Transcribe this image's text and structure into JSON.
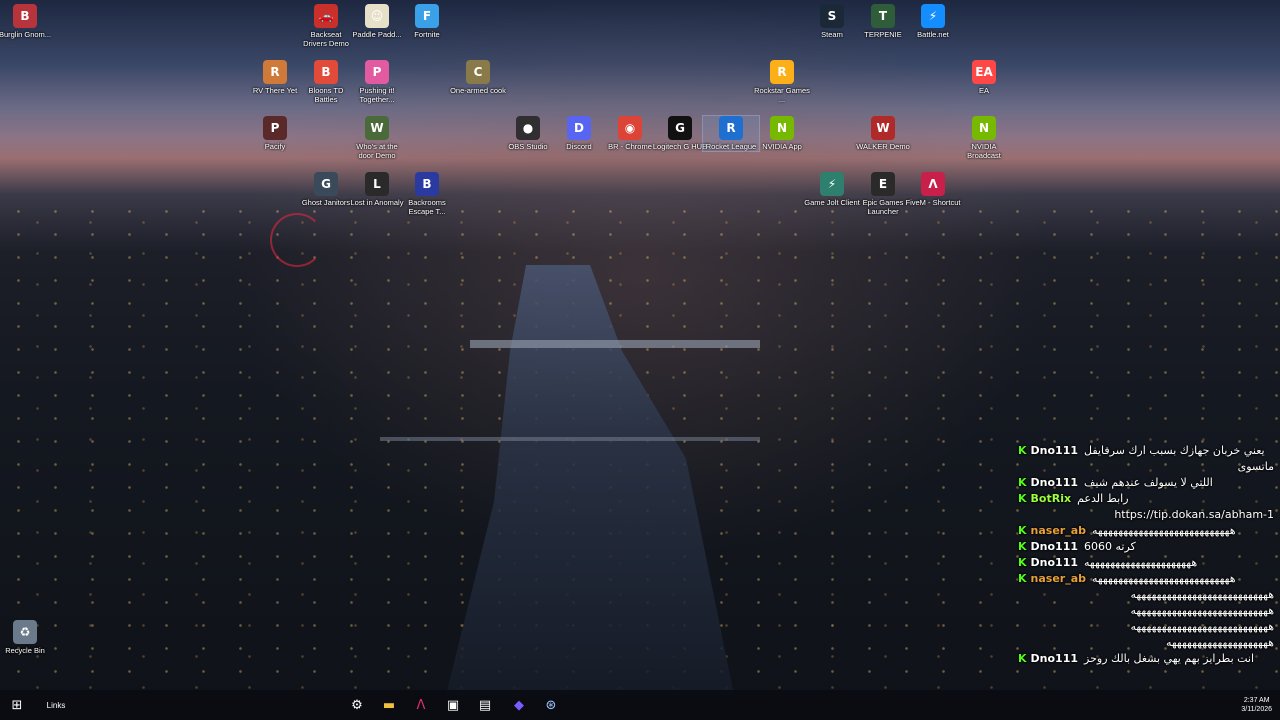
{
  "desktop_icons": [
    {
      "name": "burglin-gnomes-icon",
      "label": "Burglin Gnom...",
      "glyph": "B",
      "color": "#b8343c"
    },
    {
      "name": "backseat-drivers-icon",
      "label": "Backseat Drivers Demo",
      "glyph": "🚗",
      "color": "#c9302c"
    },
    {
      "name": "paddle-icon",
      "label": "Paddle Padd...",
      "glyph": "☺",
      "color": "#e6e0c8"
    },
    {
      "name": "fortnite-icon",
      "label": "Fortnite",
      "glyph": "F",
      "color": "#3aa0e8"
    },
    {
      "name": "steam-icon",
      "label": "Steam",
      "glyph": "S",
      "color": "#1b2838"
    },
    {
      "name": "terpenie-icon",
      "label": "TERPENIE",
      "glyph": "T",
      "color": "#2f5d3a"
    },
    {
      "name": "battlenet-icon",
      "label": "Battle.net",
      "glyph": "⚡",
      "color": "#148eff"
    },
    {
      "name": "rv-there-yet-icon",
      "label": "RV There Yet",
      "glyph": "R",
      "color": "#d07a3a"
    },
    {
      "name": "bloons-td-icon",
      "label": "Bloons TD Battles",
      "glyph": "B",
      "color": "#e24a3a"
    },
    {
      "name": "pushing-it-icon",
      "label": "Pushing it! Together...",
      "glyph": "P",
      "color": "#e25aa0"
    },
    {
      "name": "one-armed-cook-icon",
      "label": "One-armed cook",
      "glyph": "C",
      "color": "#8a7a4a"
    },
    {
      "name": "rockstar-games-icon",
      "label": "Rockstar Games ...",
      "glyph": "R",
      "color": "#fcaf17"
    },
    {
      "name": "ea-icon",
      "label": "EA",
      "glyph": "EA",
      "color": "#ff4747"
    },
    {
      "name": "pacify-icon",
      "label": "Pacify",
      "glyph": "P",
      "color": "#5a2a2a"
    },
    {
      "name": "whos-at-the-door-icon",
      "label": "Who's at the door Demo",
      "glyph": "W",
      "color": "#4a6a3a"
    },
    {
      "name": "obs-studio-icon",
      "label": "OBS Studio",
      "glyph": "●",
      "color": "#302e31"
    },
    {
      "name": "discord-icon",
      "label": "Discord",
      "glyph": "D",
      "color": "#5865f2"
    },
    {
      "name": "chrome-icon",
      "label": "BR - Chrome",
      "glyph": "◉",
      "color": "#db4437"
    },
    {
      "name": "logitech-g-hub-icon",
      "label": "Logitech G HUB",
      "glyph": "G",
      "color": "#111111"
    },
    {
      "name": "rocket-league-icon",
      "label": "Rocket League",
      "glyph": "R",
      "color": "#1f6fd0"
    },
    {
      "name": "nvidia-app-icon",
      "label": "NVIDIA App",
      "glyph": "N",
      "color": "#76b900"
    },
    {
      "name": "walker-demo-icon",
      "label": "WALKER Demo",
      "glyph": "W",
      "color": "#b02a2a"
    },
    {
      "name": "nvidia-broadcast-icon",
      "label": "NVIDIA Broadcast",
      "glyph": "N",
      "color": "#76b900"
    },
    {
      "name": "ghost-janitors-icon",
      "label": "Ghost Janitors",
      "glyph": "G",
      "color": "#3a4a5a"
    },
    {
      "name": "lost-in-anomaly-icon",
      "label": "Lost in Anomaly",
      "glyph": "L",
      "color": "#2a2a2a"
    },
    {
      "name": "backrooms-escape-icon",
      "label": "Backrooms Escape T...",
      "glyph": "B",
      "color": "#2a3aa0"
    },
    {
      "name": "game-jolt-icon",
      "label": "Game Jolt Client",
      "glyph": "⚡",
      "color": "#2f7f6f"
    },
    {
      "name": "epic-games-icon",
      "label": "Epic Games Launcher",
      "glyph": "E",
      "color": "#2a2a2a"
    },
    {
      "name": "fivem-icon",
      "label": "FiveM - Shortcut",
      "glyph": "Λ",
      "color": "#c8204a"
    },
    {
      "name": "recycle-bin-icon",
      "label": "Recycle Bin",
      "glyph": "♻",
      "color": "#6a7a8a"
    }
  ],
  "chat": [
    {
      "user": "Dno111",
      "color": "#ffffff",
      "text": "يعني خربان جهازك بسبب ارك سرفايفل"
    },
    {
      "user": "",
      "color": "#ffffff",
      "text": "ماتسوى"
    },
    {
      "user": "Dno111",
      "color": "#ffffff",
      "text": "اللتي لا يسولف عندهم شيف"
    },
    {
      "user": "BotRix",
      "color": "#9bff3b",
      "text": "رابط الدعم"
    },
    {
      "user": "",
      "color": "#ffffff",
      "text": "https://tip.dokan.sa/abham-1"
    },
    {
      "user": "naser_ab",
      "color": "#e8a13a",
      "text": "هههههههههههههههههههههههههههه"
    },
    {
      "user": "Dno111",
      "color": "#ffffff",
      "text": "كرته 6060"
    },
    {
      "user": "Dno111",
      "color": "#ffffff",
      "text": "هههههههههههههههههههههه"
    },
    {
      "user": "naser_ab",
      "color": "#e8a13a",
      "text": "هههههههههههههههههههههههههههه"
    },
    {
      "user": "",
      "color": "#ffffff",
      "text": "هههههههههههههههههههههههههههه"
    },
    {
      "user": "",
      "color": "#ffffff",
      "text": "هههههههههههههههههههههههههههه"
    },
    {
      "user": "",
      "color": "#ffffff",
      "text": "هههههههههههههههههههههههههههه"
    },
    {
      "user": "",
      "color": "#ffffff",
      "text": "ههههههههههههههههههههه"
    },
    {
      "user": "Dno111",
      "color": "#ffffff",
      "text": "انت بطرايز بهم يهي بشغل بالك روحز"
    }
  ],
  "taskbar": {
    "links_label": "Links",
    "time": "2:37 AM",
    "date": "3/11/2026"
  }
}
